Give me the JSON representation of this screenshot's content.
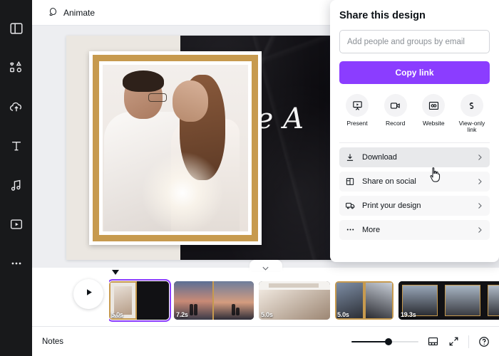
{
  "sidebar": {
    "items": [
      {
        "name": "design",
        "icon": "layout-panel-icon"
      },
      {
        "name": "elements",
        "icon": "shapes-icon"
      },
      {
        "name": "uploads",
        "icon": "cloud-upload-icon"
      },
      {
        "name": "text",
        "icon": "text-t-icon"
      },
      {
        "name": "audio",
        "icon": "music-note-icon"
      },
      {
        "name": "videos",
        "icon": "play-box-icon"
      },
      {
        "name": "more",
        "icon": "ellipsis-icon"
      }
    ]
  },
  "topbar": {
    "animate_label": "Animate",
    "animate_icon": "animate-circle-icon"
  },
  "canvas": {
    "design_script_text": "Ale A",
    "background_color": "#edeef1",
    "frame_color": "#c79a4e",
    "cream_color": "#ebe7e1"
  },
  "share_panel": {
    "title": "Share this design",
    "email_placeholder": "Add people and groups by email",
    "email_value": "",
    "copy_link_label": "Copy link",
    "accent_color": "#8b3dff",
    "quick_actions": [
      {
        "label": "Present",
        "icon": "present-screen-icon"
      },
      {
        "label": "Record",
        "icon": "video-camera-icon"
      },
      {
        "label": "Website",
        "icon": "browser-window-icon"
      },
      {
        "label": "View-only link",
        "icon": "chain-link-icon"
      }
    ],
    "menu_items": [
      {
        "label": "Download",
        "icon": "download-icon",
        "active": true
      },
      {
        "label": "Share on social",
        "icon": "share-social-icon",
        "active": false
      },
      {
        "label": "Print your design",
        "icon": "delivery-truck-icon",
        "active": false
      },
      {
        "label": "More",
        "icon": "ellipsis-icon",
        "active": false
      }
    ]
  },
  "timeline": {
    "play_label": "play-button",
    "collapse_icon": "chevron-down-icon",
    "pages": [
      {
        "duration": "5.0s",
        "selected": true
      },
      {
        "duration": "7.2s",
        "selected": false
      },
      {
        "duration": "5.0s",
        "selected": false
      },
      {
        "duration": "5.0s",
        "selected": false
      },
      {
        "duration": "19.3s",
        "selected": false
      }
    ]
  },
  "bottombar": {
    "notes_label": "Notes",
    "zoom_percent": 55,
    "icons": [
      {
        "name": "grid-view-icon"
      },
      {
        "name": "expand-fullscreen-icon"
      },
      {
        "name": "help-circle-icon"
      }
    ]
  }
}
